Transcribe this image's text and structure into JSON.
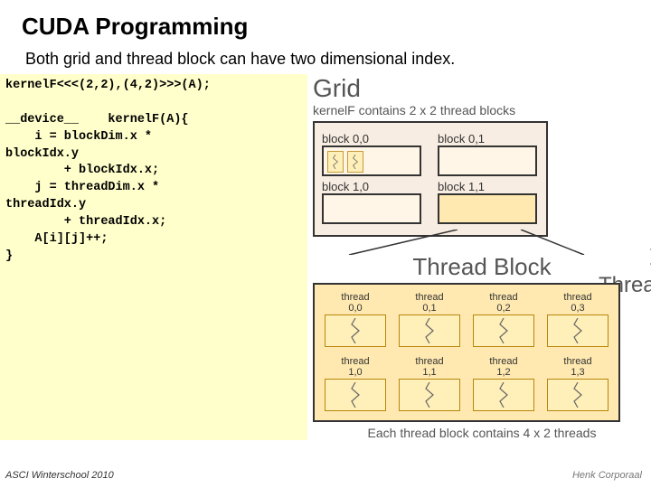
{
  "title": "CUDA Programming",
  "subtitle": "Both grid and thread block can have two dimensional index.",
  "code": "kernelF<<<(2,2),(4,2)>>>(A);\n\n__device__    kernelF(A){\n    i = blockDim.x *\nblockIdx.y\n        + blockIdx.x;\n    j = threadDim.x *\nthreadIdx.y\n        + threadIdx.x;\n    A[i][j]++;\n}",
  "grid": {
    "label": "Grid",
    "desc": "kernelF contains 2 x 2 thread blocks",
    "blocks": [
      [
        "block 0,0",
        "block 0,1"
      ],
      [
        "block 1,0",
        "block 1,1"
      ]
    ]
  },
  "thread_label": "Thread",
  "thread_block": {
    "title": "Thread Block",
    "caption": "Each thread block contains 4 x 2 threads",
    "rows": [
      [
        {
          "top": "thread",
          "bottom": "0,0"
        },
        {
          "top": "thread",
          "bottom": "0,1"
        },
        {
          "top": "thread",
          "bottom": "0,2"
        },
        {
          "top": "thread",
          "bottom": "0,3"
        }
      ],
      [
        {
          "top": "thread",
          "bottom": "1,0"
        },
        {
          "top": "thread",
          "bottom": "1,1"
        },
        {
          "top": "thread",
          "bottom": "1,2"
        },
        {
          "top": "thread",
          "bottom": "1,3"
        }
      ]
    ]
  },
  "footer": {
    "left": "ASCI Winterschool 2010",
    "right": "Henk Corporaal"
  }
}
